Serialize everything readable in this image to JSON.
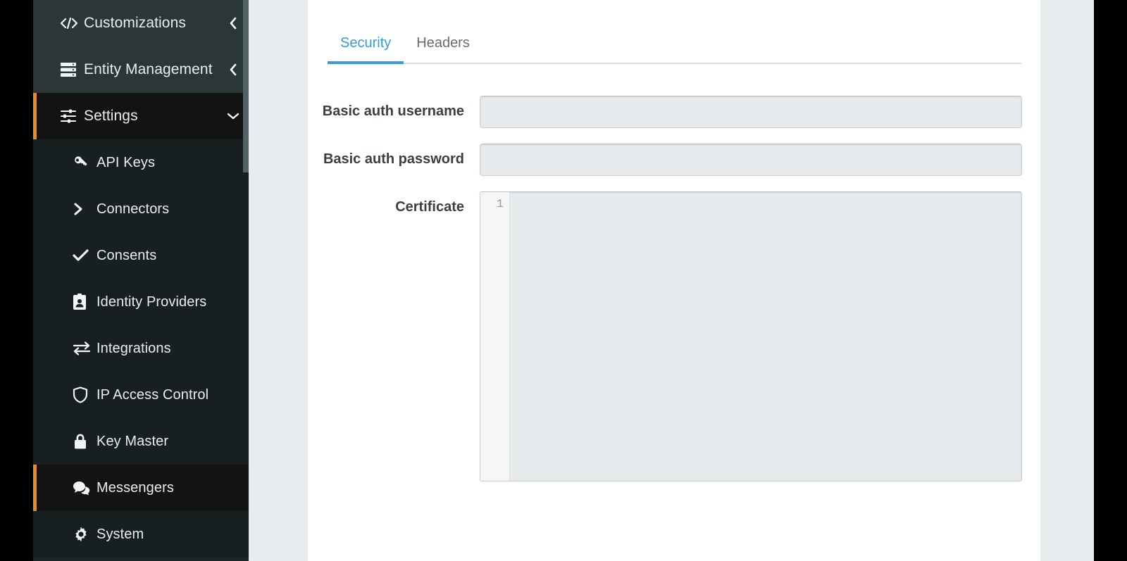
{
  "theme": {
    "sidebar_bg": "#1e2526",
    "sidebar_top_bg": "#2b3638",
    "sidebar_active_bg": "#131313",
    "accent_orange": "#f08a24",
    "tab_active_blue": "#3a9ae0",
    "page_bg": "#e8ecef",
    "panel_bg": "#ffffff",
    "input_bg": "#e6eaed",
    "label_color": "#3a3f44"
  },
  "sidebar": {
    "items": [
      {
        "label": "Customizations",
        "icon": "code-brackets-icon",
        "level": "top",
        "chevron": "chevron-left-icon",
        "active": false
      },
      {
        "label": "Entity Management",
        "icon": "server-stack-icon",
        "level": "top",
        "chevron": "chevron-left-icon",
        "active": false
      },
      {
        "label": "Settings",
        "icon": "sliders-icon",
        "level": "top",
        "chevron": "chevron-down-icon",
        "active": true
      },
      {
        "label": "API Keys",
        "icon": "key-icon",
        "level": "sub",
        "chevron": "",
        "active": false
      },
      {
        "label": "Connectors",
        "icon": "chevron-right-icon",
        "level": "sub",
        "chevron": "",
        "active": false
      },
      {
        "label": "Consents",
        "icon": "check-icon",
        "level": "sub",
        "chevron": "",
        "active": false
      },
      {
        "label": "Identity Providers",
        "icon": "id-badge-icon",
        "level": "sub",
        "chevron": "",
        "active": false
      },
      {
        "label": "Integrations",
        "icon": "exchange-arrows-icon",
        "level": "sub",
        "chevron": "",
        "active": false
      },
      {
        "label": "IP Access Control",
        "icon": "shield-icon",
        "level": "sub",
        "chevron": "",
        "active": false
      },
      {
        "label": "Key Master",
        "icon": "lock-icon",
        "level": "sub",
        "chevron": "",
        "active": false
      },
      {
        "label": "Messengers",
        "icon": "chat-bubbles-icon",
        "level": "sub",
        "chevron": "",
        "active": true
      },
      {
        "label": "System",
        "icon": "gear-icon",
        "level": "sub",
        "chevron": "",
        "active": false
      }
    ]
  },
  "main": {
    "tabs": [
      {
        "label": "Security",
        "active": true
      },
      {
        "label": "Headers",
        "active": false
      }
    ],
    "fields": {
      "basic_auth_username": {
        "label": "Basic auth username",
        "value": "",
        "placeholder": ""
      },
      "basic_auth_password": {
        "label": "Basic auth password",
        "value": "",
        "placeholder": ""
      },
      "certificate": {
        "label": "Certificate",
        "value": "",
        "line_numbers": [
          "1"
        ]
      }
    }
  }
}
